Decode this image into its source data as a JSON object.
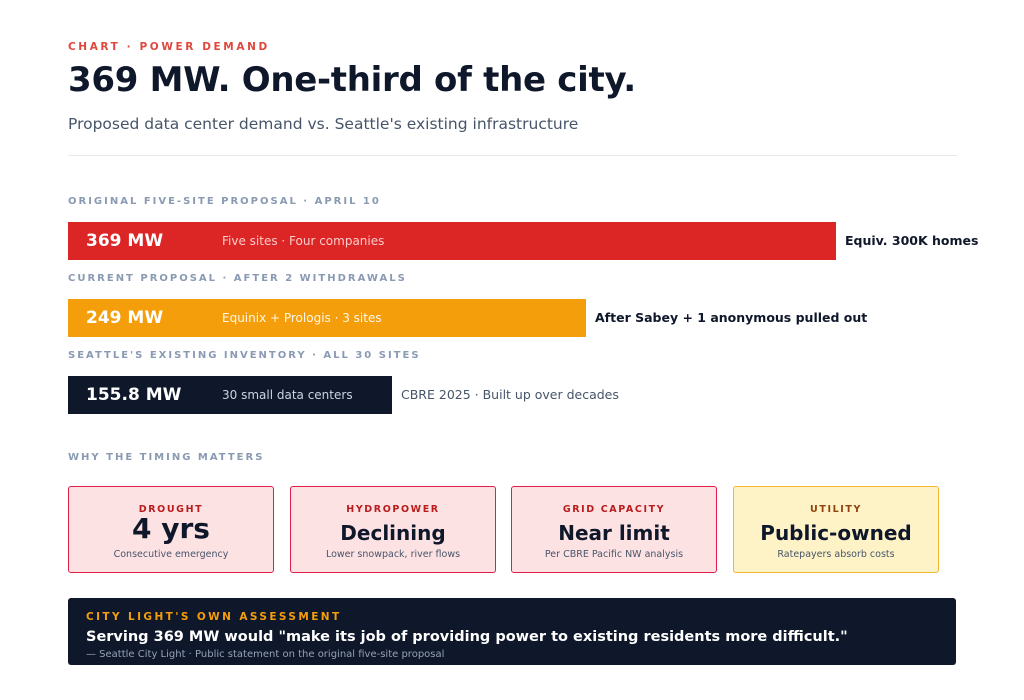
{
  "header": {
    "kicker": "CHART · POWER DEMAND",
    "title": "369 MW. One-third of the city.",
    "subtitle": "Proposed data center demand vs. Seattle's existing infrastructure"
  },
  "chart_data": {
    "type": "bar",
    "orientation": "horizontal",
    "unit": "MW",
    "bars": [
      {
        "label": "ORIGINAL FIVE-SITE PROPOSAL · APRIL 10",
        "value": 369,
        "value_label": "369 MW",
        "description": "Five sites · Four companies",
        "note": "Equiv. 300K homes",
        "color": "#dc2626"
      },
      {
        "label": "CURRENT PROPOSAL · AFTER 2 WITHDRAWALS",
        "value": 249,
        "value_label": "249 MW",
        "description": "Equinix + Prologis · 3 sites",
        "note": "After Sabey + 1 anonymous pulled out",
        "color": "#f59e0b"
      },
      {
        "label": "SEATTLE'S EXISTING INVENTORY · ALL 30 SITES",
        "value": 155.8,
        "value_label": "155.8 MW",
        "description": "30 small data centers",
        "note": "CBRE 2025 · Built up over decades",
        "color": "#0f172a"
      }
    ]
  },
  "timing": {
    "label": "WHY THE TIMING MATTERS",
    "cards": [
      {
        "label": "DROUGHT",
        "value": "4 yrs",
        "sub": "Consecutive emergency",
        "color": "#fde2e4"
      },
      {
        "label": "HYDROPOWER",
        "value": "Declining",
        "sub": "Lower snowpack, river flows",
        "color": "#fde2e4"
      },
      {
        "label": "GRID CAPACITY",
        "value": "Near limit",
        "sub": "Per CBRE Pacific NW analysis",
        "color": "#fde2e4"
      },
      {
        "label": "UTILITY",
        "value": "Public-owned",
        "sub": "Ratepayers absorb costs",
        "color": "#fef3c7"
      }
    ]
  },
  "assessment": {
    "label": "CITY LIGHT'S OWN ASSESSMENT",
    "quote": "Serving 369 MW would \"make its job of providing power to existing residents more difficult.\"",
    "cite": "— Seattle City Light · Public statement on the original five-site proposal"
  }
}
